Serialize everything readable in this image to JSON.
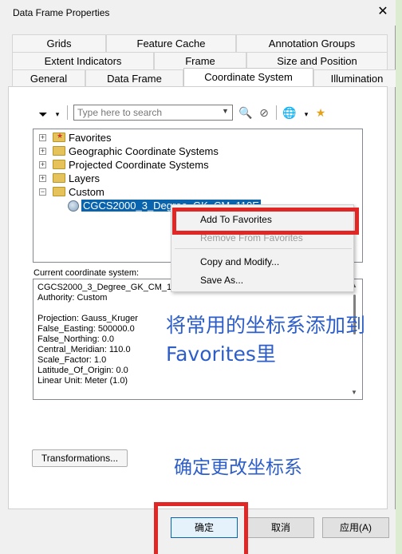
{
  "window": {
    "title": "Data Frame Properties",
    "close_glyph": "✕"
  },
  "tabs": {
    "row1": [
      "Grids",
      "Feature Cache",
      "Annotation Groups"
    ],
    "row2": [
      "Extent Indicators",
      "Frame",
      "Size and Position"
    ],
    "row3": [
      "General",
      "Data Frame",
      "Coordinate System",
      "Illumination"
    ],
    "active": "Coordinate System"
  },
  "toolbar": {
    "search_placeholder": "Type here to search"
  },
  "tree": {
    "items": [
      {
        "label": "Favorites",
        "expander": "+"
      },
      {
        "label": "Geographic Coordinate Systems",
        "expander": "+"
      },
      {
        "label": "Projected Coordinate Systems",
        "expander": "+"
      },
      {
        "label": "Layers",
        "expander": "+"
      },
      {
        "label": "Custom",
        "expander": "−"
      }
    ],
    "selected": "CGCS2000_3_Degree_GK_CM_110E"
  },
  "context_menu": {
    "items": [
      "Add To Favorites",
      "Remove From Favorites",
      "Copy and Modify...",
      "Save As..."
    ]
  },
  "current": {
    "label": "Current coordinate system:",
    "lines": [
      "CGCS2000_3_Degree_GK_CM_110E",
      "Authority: Custom",
      "",
      "Projection: Gauss_Kruger",
      "False_Easting: 500000.0",
      "False_Northing: 0.0",
      "Central_Meridian: 110.0",
      "Scale_Factor: 1.0",
      "Latitude_Of_Origin: 0.0",
      "Linear Unit: Meter (1.0)"
    ]
  },
  "annotations": {
    "line1": "将常用的坐标系添加到",
    "line2": "Favorites里",
    "confirm_note": "确定更改坐标系"
  },
  "buttons": {
    "transformations": "Transformations...",
    "ok": "确定",
    "cancel": "取消",
    "apply": "应用(A)"
  },
  "colors": {
    "highlight": "#e12626",
    "annotation": "#2d5ec8",
    "selection": "#0a64ad"
  }
}
